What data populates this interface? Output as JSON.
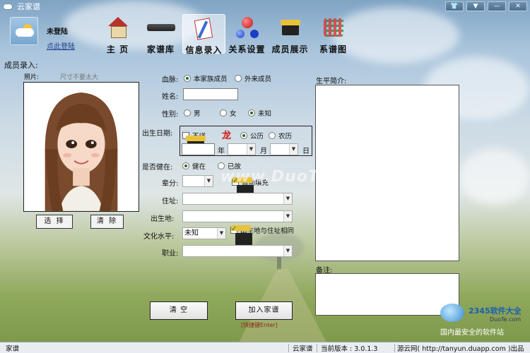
{
  "window": {
    "title": "云家谱",
    "controls": [
      "tshirt-icon",
      "dropdown-icon",
      "minimize-icon",
      "close-icon"
    ]
  },
  "user": {
    "name": "未登陆",
    "login_link": "点此登陆"
  },
  "nav": {
    "items": [
      {
        "label": "主 页",
        "icon": "house-icon",
        "active": false
      },
      {
        "label": "家谱库",
        "icon": "book-icon",
        "active": false
      },
      {
        "label": "信息录入",
        "icon": "cards-icon",
        "active": true
      },
      {
        "label": "关系设置",
        "icon": "molecule-icon",
        "active": false
      },
      {
        "label": "成员展示",
        "icon": "box-icon",
        "active": false
      },
      {
        "label": "系谱图",
        "icon": "tree-chart-icon",
        "active": false
      }
    ]
  },
  "form": {
    "section_title": "成员录入:",
    "photo": {
      "label": "照片:",
      "hint": "尺寸不要太大",
      "select_button": "选 择",
      "clear_button": "清 除"
    },
    "bloodline": {
      "label": "血脉:",
      "options": [
        "本家族成员",
        "外来成员"
      ],
      "selected": 0
    },
    "name": {
      "label": "姓名:",
      "value": ""
    },
    "gender": {
      "label": "性别:",
      "options": [
        "男",
        "女",
        "未知"
      ],
      "selected": 2
    },
    "birthdate": {
      "label": "出生日期:",
      "unknown_checkbox": "不详",
      "zodiac": "龙",
      "calendar_options": [
        "公历",
        "农历"
      ],
      "selected": 0,
      "year_unit": "年",
      "month_unit": "月",
      "day_unit": "日"
    },
    "alive": {
      "label": "是否健在:",
      "options": [
        "健在",
        "已故"
      ],
      "selected": 0
    },
    "generation": {
      "label": "辈分:",
      "auto_fill": "自动填充"
    },
    "address": {
      "label": "住址:"
    },
    "birthplace": {
      "label": "出生地:"
    },
    "education": {
      "label": "文化水平:",
      "value": "未知",
      "same_as_address": "出生地与住址相同"
    },
    "occupation": {
      "label": "职业:"
    },
    "bio": {
      "label": "生平简介:"
    },
    "notes": {
      "label": "备注:"
    },
    "clear_button": "清 空",
    "add_button": "加入家谱",
    "shortcut": "[快捷键Enter]"
  },
  "watermark": {
    "text": "www.DuoTe.com",
    "corner_brand": "2345软件大全",
    "corner_url": "DuoTe.com",
    "corner_slogan": "国内最安全的软件站"
  },
  "status": {
    "left": "家谱",
    "app": "云家谱",
    "version": "当前版本 : 3.0.1.3",
    "publisher": "源云网( http://tanyun.duapp.com )出品"
  },
  "colors": {
    "zodiac_red": "#d01818",
    "link_blue": "#1c3c8c"
  }
}
